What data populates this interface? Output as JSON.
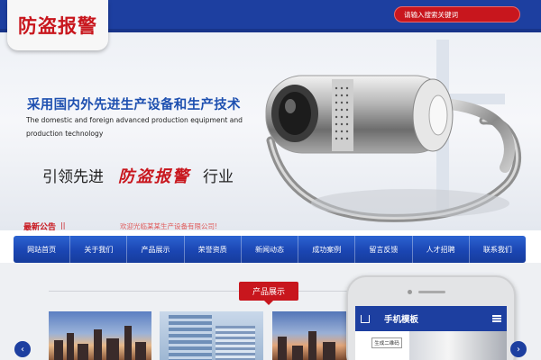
{
  "header": {
    "logo_text": "防盗报警",
    "search_placeholder": "请输入搜索关键词",
    "colors": {
      "brand_blue": "#1d3fa0",
      "brand_red": "#c8161d"
    }
  },
  "banner": {
    "headline": "采用国内外先进生产设备和生产技术",
    "english": "The domestic and foreign advanced production equipment and production technology",
    "lead_prefix": "引领先进",
    "lead_highlight": "防盗报警",
    "lead_suffix": "行业",
    "image": "webcam-product-photo"
  },
  "news": {
    "title": "最新公告",
    "separator": "||",
    "text": "欢迎光临某某生产设备有限公司!"
  },
  "nav": {
    "items": [
      {
        "label": "网站首页"
      },
      {
        "label": "关于我们"
      },
      {
        "label": "产品展示"
      },
      {
        "label": "荣誉资质"
      },
      {
        "label": "新闻动态"
      },
      {
        "label": "成功案例"
      },
      {
        "label": "留言反馈"
      },
      {
        "label": "人才招聘"
      },
      {
        "label": "联系我们"
      }
    ]
  },
  "products": {
    "section_title": "产品展示",
    "prev_icon": "chevron-left-icon",
    "next_icon": "chevron-right-icon"
  },
  "phone": {
    "title": "手机模板",
    "qr_label": "生成二维码"
  }
}
